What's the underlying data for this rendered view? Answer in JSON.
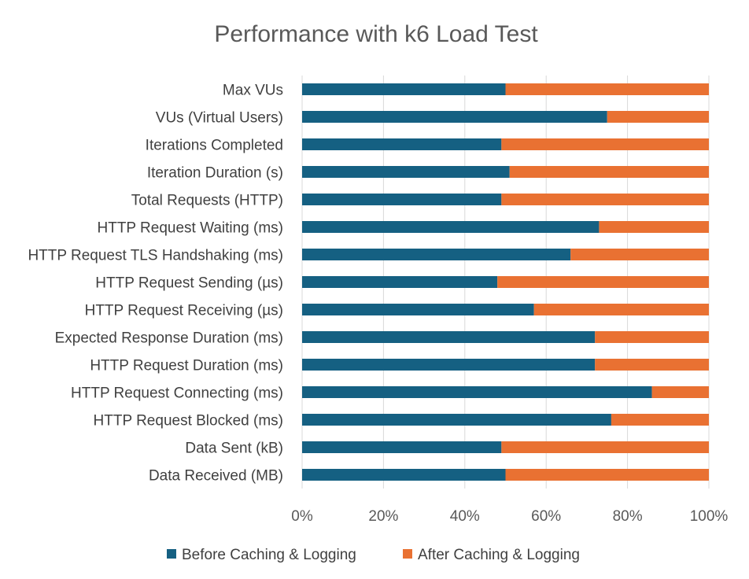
{
  "chart_data": {
    "type": "bar",
    "orientation": "horizontal",
    "stacked": "percent",
    "title": "Performance with k6 Load Test",
    "categories": [
      "Max VUs",
      "VUs (Virtual Users)",
      "Iterations Completed",
      "Iteration Duration (s)",
      "Total Requests (HTTP)",
      "HTTP Request Waiting (ms)",
      "HTTP Request TLS Handshaking (ms)",
      "HTTP Request Sending (µs)",
      "HTTP Request Receiving (µs)",
      "Expected Response Duration (ms)",
      "HTTP Request Duration (ms)",
      "HTTP Request Connecting (ms)",
      "HTTP Request Blocked (ms)",
      "Data Sent (kB)",
      "Data Received (MB)"
    ],
    "series": [
      {
        "name": "Before Caching & Logging",
        "color": "#156082",
        "values": [
          50,
          75,
          49,
          51,
          49,
          73,
          66,
          48,
          57,
          72,
          72,
          86,
          76,
          49,
          50
        ]
      },
      {
        "name": "After Caching & Logging",
        "color": "#e97132",
        "values": [
          50,
          25,
          51,
          49,
          51,
          27,
          34,
          52,
          43,
          28,
          28,
          14,
          24,
          51,
          50
        ]
      }
    ],
    "x_axis": {
      "range": [
        0,
        100
      ],
      "ticks": [
        "0%",
        "20%",
        "40%",
        "60%",
        "80%",
        "100%"
      ]
    },
    "xlabel": "",
    "ylabel": "",
    "grid": "vertical",
    "legend_position": "bottom"
  }
}
